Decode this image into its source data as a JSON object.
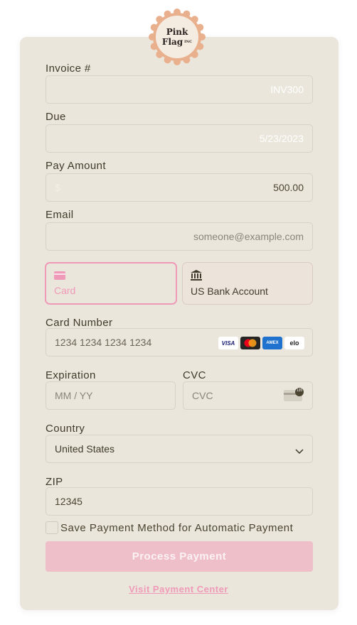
{
  "logo": {
    "line1": "Pink",
    "line2": "Flag",
    "suffix": "INC"
  },
  "invoice": {
    "label": "Invoice #",
    "value": "INV300"
  },
  "due": {
    "label": "Due",
    "value": "5/23/2023"
  },
  "amount": {
    "label": "Pay Amount",
    "prefix": "$",
    "value": "500.00"
  },
  "email": {
    "label": "Email",
    "placeholder": "someone@example.com"
  },
  "methods": [
    {
      "label": "Card",
      "selected": true
    },
    {
      "label": "US Bank Account",
      "selected": false
    }
  ],
  "card_number": {
    "label": "Card Number",
    "placeholder": "1234 1234 1234 1234",
    "brands": [
      "VISA",
      "mastercard",
      "AMEX",
      "elo"
    ]
  },
  "expiration": {
    "label": "Expiration",
    "placeholder": "MM / YY"
  },
  "cvc": {
    "label": "CVC",
    "placeholder": "CVC",
    "badge": "135"
  },
  "country": {
    "label": "Country",
    "value": "United States"
  },
  "zip": {
    "label": "ZIP",
    "value": "12345"
  },
  "save_method": {
    "label": "Save Payment Method for Automatic Payment",
    "checked": false
  },
  "submit": {
    "label": "Process Payment"
  },
  "footer_link": {
    "label": "Visit Payment Center"
  },
  "colors": {
    "accent": "#ef9ab8",
    "panel": "#ebe6db",
    "button": "#efbfc9"
  }
}
